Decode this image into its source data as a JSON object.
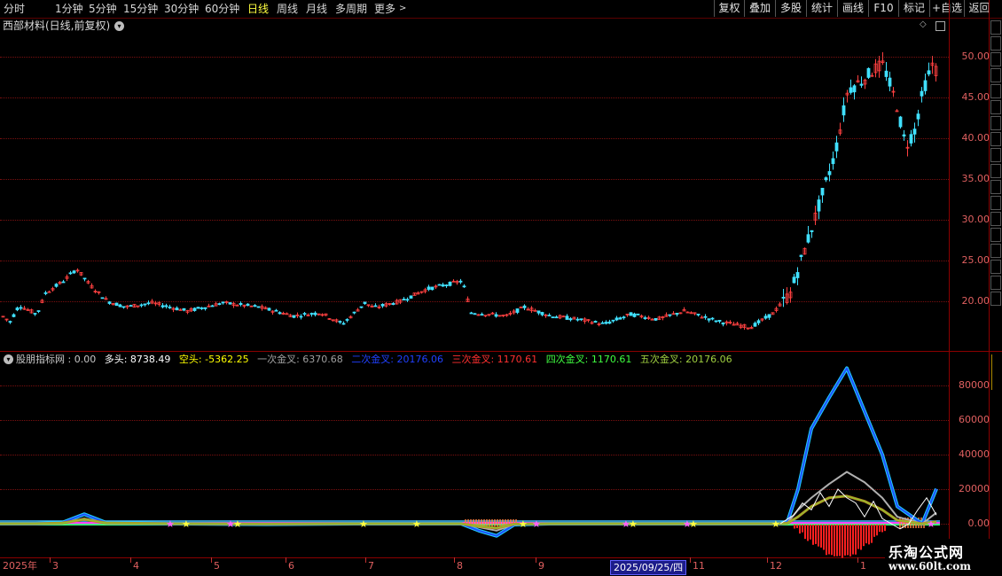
{
  "periods": [
    {
      "label": "分时",
      "active": false
    },
    {
      "label": "1分钟",
      "active": false
    },
    {
      "label": "5分钟",
      "active": false
    },
    {
      "label": "15分钟",
      "active": false
    },
    {
      "label": "30分钟",
      "active": false
    },
    {
      "label": "60分钟",
      "active": false
    },
    {
      "label": "日线",
      "active": true
    },
    {
      "label": "周线",
      "active": false
    },
    {
      "label": "月线",
      "active": false
    },
    {
      "label": "多周期",
      "active": false
    },
    {
      "label": "更多",
      "active": false
    }
  ],
  "toolbar": [
    "复权",
    "叠加",
    "多股",
    "统计",
    "画线",
    "F10",
    "标记",
    "+自选",
    "返回"
  ],
  "main_title": "西部材料(日线,前复权)",
  "price_ticks": [
    "50.00",
    "45.00",
    "40.00",
    "35.00",
    "30.00",
    "25.00",
    "20.00"
  ],
  "indicator_ticks": [
    "80000",
    "60000",
    "40000",
    "20000",
    "0.00"
  ],
  "indicator_legend": [
    {
      "text": "股朋指标网 : 0.00",
      "color": "#c8c8c8"
    },
    {
      "text": "多头: 8738.49",
      "color": "#ffffff"
    },
    {
      "text": "空头: -5362.25",
      "color": "#ffff00"
    },
    {
      "text": "一次金叉: 6370.68",
      "color": "#a0a0a0"
    },
    {
      "text": "二次金叉: 20176.06",
      "color": "#2040ff"
    },
    {
      "text": "三次金叉: 1170.61",
      "color": "#ff3030"
    },
    {
      "text": "四次金叉: 1170.61",
      "color": "#40ff40"
    },
    {
      "text": "五次金叉: 20176.06",
      "color": "#a0d040"
    }
  ],
  "x_ticks": [
    "2025年",
    "3",
    "4",
    "5",
    "6",
    "7",
    "8",
    "9",
    "11",
    "12",
    "1"
  ],
  "date_badge": "2025/09/25/四",
  "watermark": {
    "main": "乐淘公式网",
    "sub": "www.60lt.com"
  },
  "colors": {
    "up": "#ff4040",
    "down": "#40e0ff",
    "grid": "#7a1010",
    "axis": "#e06060"
  },
  "icons": [
    "chevron-down-icon",
    "diamond-icon",
    "window-icon",
    "chevron-right-icon"
  ],
  "chart_data": [
    {
      "type": "candlestick",
      "ylim": [
        15,
        53
      ],
      "x_range": [
        "2025年",
        "1"
      ],
      "grid": true
    },
    {
      "type": "line",
      "ylim": [
        -12000,
        90000
      ],
      "series": [
        {
          "name": "二次金叉",
          "values": [
            0,
            0,
            600,
            5500,
            500,
            0,
            -300,
            0,
            0,
            0,
            -4000,
            -7000,
            -500,
            0,
            0,
            0,
            0,
            0,
            0,
            0,
            0,
            1000,
            20000,
            55000,
            73000,
            90000,
            65000,
            40000,
            10000,
            0,
            20176
          ]
        },
        {
          "name": "一次金叉",
          "values": [
            0,
            0,
            300,
            3000,
            300,
            0,
            -200,
            0,
            0,
            0,
            -2000,
            -4000,
            -300,
            0,
            0,
            0,
            0,
            0,
            0,
            0,
            0,
            500,
            8000,
            15000,
            23000,
            30000,
            24000,
            15000,
            4000,
            0,
            6370
          ]
        },
        {
          "name": "五次金叉",
          "values": [
            0,
            0,
            400,
            2500,
            400,
            0,
            -100,
            0,
            0,
            0,
            -1500,
            -2500,
            -200,
            0,
            0,
            0,
            0,
            0,
            0,
            0,
            0,
            300,
            4000,
            10000,
            15000,
            16000,
            13000,
            8000,
            2000,
            0,
            1170
          ]
        }
      ]
    }
  ]
}
